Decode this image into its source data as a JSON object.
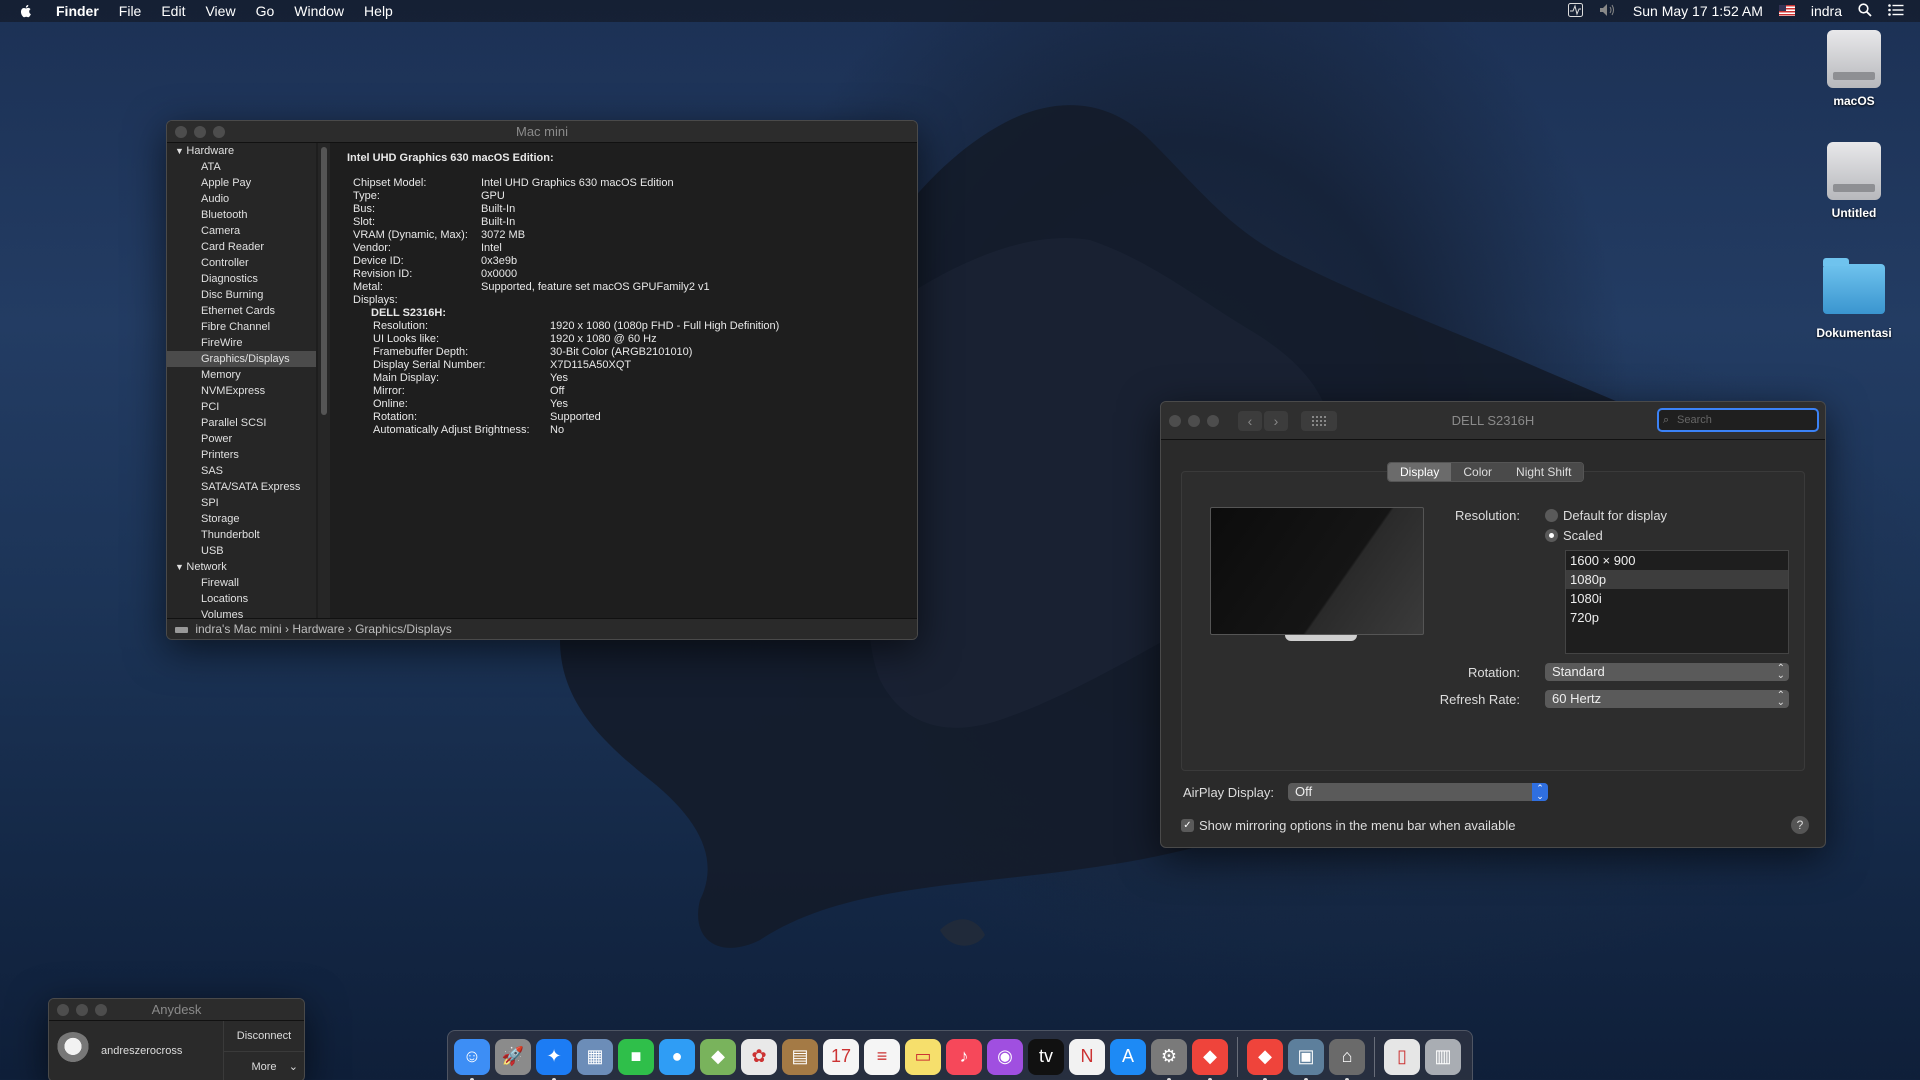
{
  "menubar": {
    "app": "Finder",
    "items": [
      "File",
      "Edit",
      "View",
      "Go",
      "Window",
      "Help"
    ],
    "datetime": "Sun May 17  1:52 AM",
    "user": "indra"
  },
  "desktop_icons": [
    {
      "label": "macOS",
      "icon": "hard-drive-icon"
    },
    {
      "label": "Untitled",
      "icon": "hard-drive-icon"
    },
    {
      "label": "Dokumentasi",
      "icon": "folder-icon"
    }
  ],
  "sysinfo": {
    "title": "Mac mini",
    "sidebar": [
      {
        "label": "Hardware",
        "group": true
      },
      {
        "label": "ATA"
      },
      {
        "label": "Apple Pay"
      },
      {
        "label": "Audio"
      },
      {
        "label": "Bluetooth"
      },
      {
        "label": "Camera"
      },
      {
        "label": "Card Reader"
      },
      {
        "label": "Controller"
      },
      {
        "label": "Diagnostics"
      },
      {
        "label": "Disc Burning"
      },
      {
        "label": "Ethernet Cards"
      },
      {
        "label": "Fibre Channel"
      },
      {
        "label": "FireWire"
      },
      {
        "label": "Graphics/Displays",
        "selected": true
      },
      {
        "label": "Memory"
      },
      {
        "label": "NVMExpress"
      },
      {
        "label": "PCI"
      },
      {
        "label": "Parallel SCSI"
      },
      {
        "label": "Power"
      },
      {
        "label": "Printers"
      },
      {
        "label": "SAS"
      },
      {
        "label": "SATA/SATA Express"
      },
      {
        "label": "SPI"
      },
      {
        "label": "Storage"
      },
      {
        "label": "Thunderbolt"
      },
      {
        "label": "USB"
      },
      {
        "label": "Network",
        "group": true
      },
      {
        "label": "Firewall"
      },
      {
        "label": "Locations"
      },
      {
        "label": "Volumes"
      }
    ],
    "header": "Intel UHD Graphics 630 macOS Edition:",
    "gpu_props": [
      {
        "k": "Chipset Model:",
        "v": "Intel UHD Graphics 630 macOS Edition"
      },
      {
        "k": "Type:",
        "v": "GPU"
      },
      {
        "k": "Bus:",
        "v": "Built-In"
      },
      {
        "k": "Slot:",
        "v": "Built-In"
      },
      {
        "k": "VRAM (Dynamic, Max):",
        "v": "3072 MB"
      },
      {
        "k": "Vendor:",
        "v": "Intel"
      },
      {
        "k": "Device ID:",
        "v": "0x3e9b"
      },
      {
        "k": "Revision ID:",
        "v": "0x0000"
      },
      {
        "k": "Metal:",
        "v": "Supported, feature set macOS GPUFamily2 v1"
      },
      {
        "k": "Displays:",
        "v": ""
      }
    ],
    "display_name": "DELL S2316H:",
    "display_props": [
      {
        "k": "Resolution:",
        "v": "1920 x 1080 (1080p FHD - Full High Definition)"
      },
      {
        "k": "UI Looks like:",
        "v": "1920 x 1080 @ 60 Hz"
      },
      {
        "k": "Framebuffer Depth:",
        "v": "30-Bit Color (ARGB2101010)"
      },
      {
        "k": "Display Serial Number:",
        "v": "X7D115A50XQT"
      },
      {
        "k": "Main Display:",
        "v": "Yes"
      },
      {
        "k": "Mirror:",
        "v": "Off"
      },
      {
        "k": "Online:",
        "v": "Yes"
      },
      {
        "k": "Rotation:",
        "v": "Supported"
      },
      {
        "k": "Automatically Adjust Brightness:",
        "v": "No"
      }
    ],
    "path": [
      "indra's Mac mini",
      "Hardware",
      "Graphics/Displays"
    ]
  },
  "prefs": {
    "title": "DELL S2316H",
    "search_placeholder": "Search",
    "tabs": [
      "Display",
      "Color",
      "Night Shift"
    ],
    "active_tab": "Display",
    "resolution_label": "Resolution:",
    "res_default": "Default for display",
    "res_scaled": "Scaled",
    "scaled_selected": true,
    "resolutions": [
      "1600 × 900",
      "1080p",
      "1080i",
      "720p"
    ],
    "selected_resolution": "1080p",
    "rotation_label": "Rotation:",
    "rotation_value": "Standard",
    "refresh_label": "Refresh Rate:",
    "refresh_value": "60 Hertz",
    "airplay_label": "AirPlay Display:",
    "airplay_value": "Off",
    "mirror_option": "Show mirroring options in the menu bar when available",
    "mirror_checked": true,
    "help": "?"
  },
  "anydesk": {
    "title": "Anydesk",
    "user": "andreszerocross",
    "disconnect": "Disconnect",
    "more": "More"
  },
  "dock": {
    "apps": [
      {
        "name": "finder-icon",
        "color": "#3d8ef5"
      },
      {
        "name": "launchpad-icon",
        "color": "#8b8b8b"
      },
      {
        "name": "safari-icon",
        "color": "#1c7cf4"
      },
      {
        "name": "preview-icon",
        "color": "#6c8db8"
      },
      {
        "name": "facetime-icon",
        "color": "#2fbf4a"
      },
      {
        "name": "messages-icon",
        "color": "#2f9df5"
      },
      {
        "name": "maps-icon",
        "color": "#79b35c"
      },
      {
        "name": "photos-icon",
        "color": "#e9e9e9"
      },
      {
        "name": "notebook-icon",
        "color": "#a47a45"
      },
      {
        "name": "calendar-icon",
        "color": "#f5f5f5"
      },
      {
        "name": "reminders-icon",
        "color": "#f5f5f5"
      },
      {
        "name": "notes-icon",
        "color": "#f6df6c"
      },
      {
        "name": "music-icon",
        "color": "#f6485a"
      },
      {
        "name": "podcasts-icon",
        "color": "#a04fe0"
      },
      {
        "name": "apple-tv-icon",
        "color": "#111111"
      },
      {
        "name": "news-icon",
        "color": "#f2f2f2"
      },
      {
        "name": "app-store-icon",
        "color": "#1d8af5"
      },
      {
        "name": "system-preferences-icon",
        "color": "#7a7a7a"
      },
      {
        "name": "anydesk-icon",
        "color": "#ef443b"
      }
    ],
    "extras": [
      {
        "name": "anydesk-doc-icon",
        "color": "#ef443b"
      },
      {
        "name": "system-information-icon",
        "color": "#5d7f9c"
      },
      {
        "name": "hanger-icon",
        "color": "#6a6a6a"
      }
    ],
    "docs": [
      {
        "name": "document-icon",
        "color": "#e6e6e6"
      },
      {
        "name": "trash-icon",
        "color": "#a9adb3"
      }
    ]
  }
}
